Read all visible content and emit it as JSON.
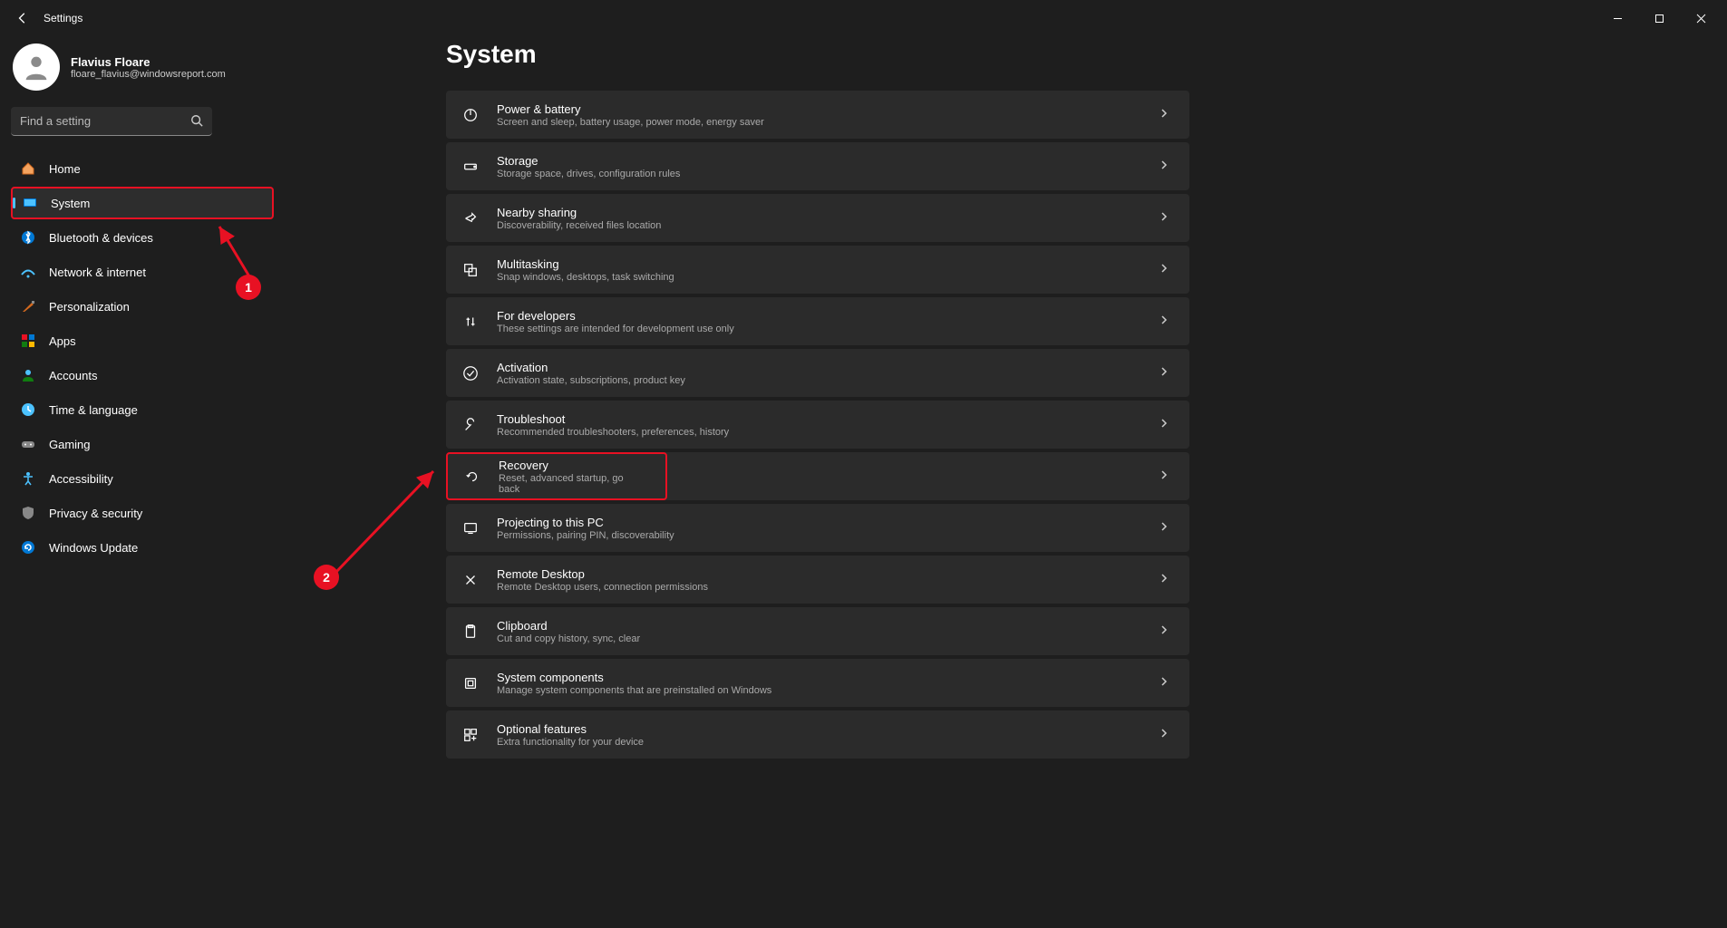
{
  "window": {
    "title": "Settings"
  },
  "profile": {
    "name": "Flavius Floare",
    "email": "floare_flavius@windowsreport.com"
  },
  "search": {
    "placeholder": "Find a setting"
  },
  "sidebar": {
    "items": [
      {
        "label": "Home",
        "icon": "home"
      },
      {
        "label": "System",
        "icon": "system",
        "active": true,
        "highlight": true
      },
      {
        "label": "Bluetooth & devices",
        "icon": "bluetooth"
      },
      {
        "label": "Network & internet",
        "icon": "network"
      },
      {
        "label": "Personalization",
        "icon": "personalization"
      },
      {
        "label": "Apps",
        "icon": "apps"
      },
      {
        "label": "Accounts",
        "icon": "accounts"
      },
      {
        "label": "Time & language",
        "icon": "time"
      },
      {
        "label": "Gaming",
        "icon": "gaming"
      },
      {
        "label": "Accessibility",
        "icon": "accessibility"
      },
      {
        "label": "Privacy & security",
        "icon": "privacy"
      },
      {
        "label": "Windows Update",
        "icon": "update"
      }
    ]
  },
  "page": {
    "title": "System",
    "cards": [
      {
        "title": "Power & battery",
        "sub": "Screen and sleep, battery usage, power mode, energy saver",
        "icon": "power"
      },
      {
        "title": "Storage",
        "sub": "Storage space, drives, configuration rules",
        "icon": "storage"
      },
      {
        "title": "Nearby sharing",
        "sub": "Discoverability, received files location",
        "icon": "share"
      },
      {
        "title": "Multitasking",
        "sub": "Snap windows, desktops, task switching",
        "icon": "multitask"
      },
      {
        "title": "For developers",
        "sub": "These settings are intended for development use only",
        "icon": "dev"
      },
      {
        "title": "Activation",
        "sub": "Activation state, subscriptions, product key",
        "icon": "check"
      },
      {
        "title": "Troubleshoot",
        "sub": "Recommended troubleshooters, preferences, history",
        "icon": "wrench"
      },
      {
        "title": "Recovery",
        "sub": "Reset, advanced startup, go back",
        "icon": "recovery",
        "highlight": true
      },
      {
        "title": "Projecting to this PC",
        "sub": "Permissions, pairing PIN, discoverability",
        "icon": "project"
      },
      {
        "title": "Remote Desktop",
        "sub": "Remote Desktop users, connection permissions",
        "icon": "remote"
      },
      {
        "title": "Clipboard",
        "sub": "Cut and copy history, sync, clear",
        "icon": "clipboard"
      },
      {
        "title": "System components",
        "sub": "Manage system components that are preinstalled on Windows",
        "icon": "components"
      },
      {
        "title": "Optional features",
        "sub": "Extra functionality for your device",
        "icon": "features"
      }
    ]
  },
  "annotations": {
    "marker1": "1",
    "marker2": "2"
  }
}
